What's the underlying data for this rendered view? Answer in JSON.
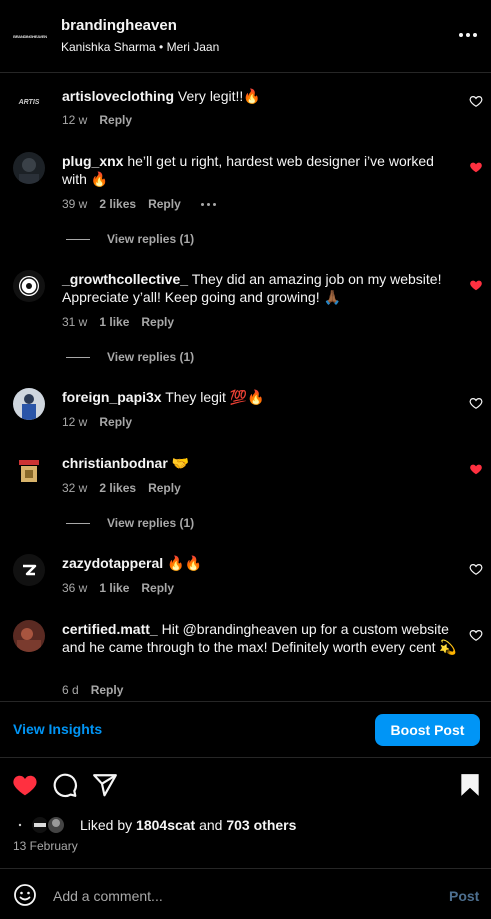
{
  "header": {
    "username": "brandingheaven",
    "subtitle": "Kanishka Sharma • Meri Jaan",
    "logo_text": "BRANDINGHEAVEN"
  },
  "comments": [
    {
      "username": "artisloveclothing",
      "text": "Very legit!!🔥",
      "time": "12 w",
      "likes": "",
      "reply": "Reply",
      "liked": false
    },
    {
      "username": "plug_xnx",
      "text": "he’ll get u right, hardest web designer i’ve worked with 🔥",
      "time": "39 w",
      "likes": "2 likes",
      "reply": "Reply",
      "liked": true,
      "view_replies": "View replies (1)"
    },
    {
      "username": "_growthcollective_",
      "text": "They did an amazing job on my website! Appreciate y’all! Keep going and growing! 🙏🏾",
      "time": "31 w",
      "likes": "1 like",
      "reply": "Reply",
      "liked": true,
      "view_replies": "View replies (1)"
    },
    {
      "username": "foreign_papi3x",
      "text": "They legit 💯🔥",
      "time": "12 w",
      "likes": "",
      "reply": "Reply",
      "liked": false
    },
    {
      "username": "christianbodnar",
      "text": "🤝",
      "time": "32 w",
      "likes": "2 likes",
      "reply": "Reply",
      "liked": true,
      "view_replies": "View replies (1)"
    },
    {
      "username": "zazydotapperal",
      "text": "🔥🔥",
      "time": "36 w",
      "likes": "1 like",
      "reply": "Reply",
      "liked": false
    },
    {
      "username": "certified.matt_",
      "text": "Hit @brandingheaven up for a custom website and he came through to the max! Definitely worth every cent 💫",
      "time": "6 d",
      "likes": "",
      "reply": "Reply",
      "liked": false
    }
  ],
  "actions": {
    "view_insights": "View Insights",
    "boost_post": "Boost Post"
  },
  "likes": {
    "prefix": "Liked by ",
    "user": "1804scat",
    "middle": " and ",
    "others": "703 others"
  },
  "date": "13 February",
  "add_comment": {
    "placeholder": "Add a comment...",
    "post_label": "Post"
  },
  "colors": {
    "accent": "#0095f6",
    "heart": "#ff3040",
    "muted": "#a8a8a8",
    "background": "#000000"
  }
}
